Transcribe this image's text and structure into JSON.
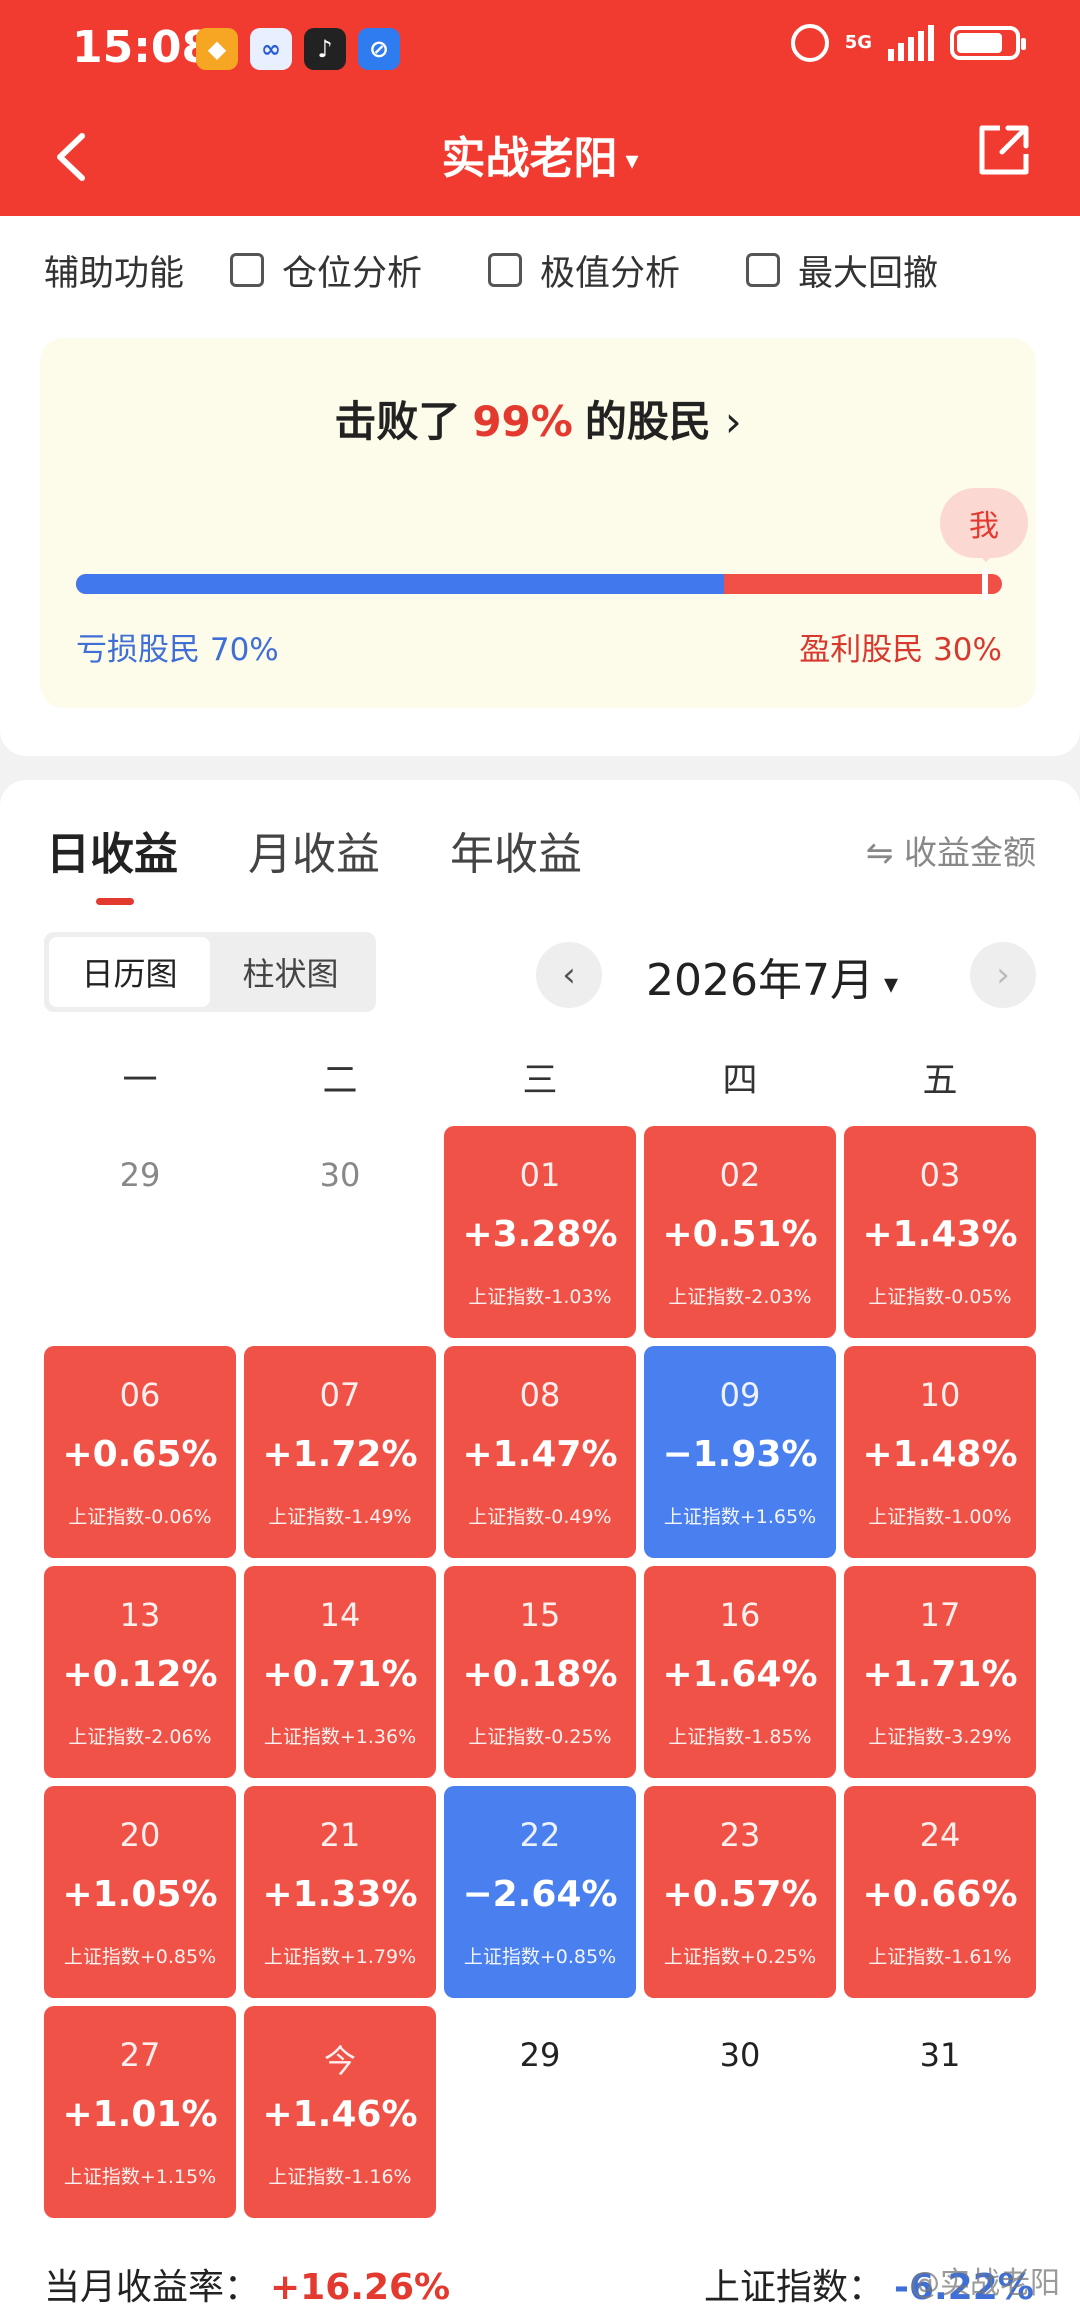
{
  "status_bar": {
    "time": "15:08",
    "network": "5G",
    "icons": [
      "app-icon-1",
      "app-icon-2",
      "app-icon-3",
      "app-icon-4",
      "alarm-icon",
      "signal-icon",
      "battery-icon"
    ]
  },
  "nav": {
    "title": "实战老阳",
    "caret": "▾",
    "back_icon": "chevron-left-icon",
    "share_icon": "share-icon"
  },
  "aux": {
    "title": "辅助功能",
    "options": [
      {
        "label": "仓位分析",
        "checked": false
      },
      {
        "label": "极值分析",
        "checked": false
      },
      {
        "label": "最大回撤",
        "checked": false
      }
    ]
  },
  "beat": {
    "prefix": "击败了",
    "percent": "99%",
    "suffix": "的股民",
    "arrow": "›",
    "me_label": "我",
    "loss_label": "亏损股民 70%",
    "gain_label": "盈利股民 30%",
    "loss_fraction": 0.7,
    "my_position": 0.99
  },
  "tabs": {
    "items": [
      "日收益",
      "月收益",
      "年收益"
    ],
    "active": 0,
    "amount_toggle": "⇋ 收益金额"
  },
  "view_toggle": {
    "options": [
      "日历图",
      "柱状图"
    ],
    "active": 0
  },
  "month_nav": {
    "label": "2026年7月",
    "caret": "▾",
    "prev": "‹",
    "next": "›"
  },
  "weekdays": [
    "一",
    "二",
    "三",
    "四",
    "五"
  ],
  "calendar": [
    {
      "day": "29",
      "type": "empty"
    },
    {
      "day": "30",
      "type": "empty"
    },
    {
      "day": "01",
      "type": "up",
      "value": "+3.28%",
      "index": "上证指数-1.03%"
    },
    {
      "day": "02",
      "type": "up",
      "value": "+0.51%",
      "index": "上证指数-2.03%"
    },
    {
      "day": "03",
      "type": "up",
      "value": "+1.43%",
      "index": "上证指数-0.05%"
    },
    {
      "day": "06",
      "type": "up",
      "value": "+0.65%",
      "index": "上证指数-0.06%"
    },
    {
      "day": "07",
      "type": "up",
      "value": "+1.72%",
      "index": "上证指数-1.49%"
    },
    {
      "day": "08",
      "type": "up",
      "value": "+1.47%",
      "index": "上证指数-0.49%"
    },
    {
      "day": "09",
      "type": "down",
      "value": "−1.93%",
      "index": "上证指数+1.65%"
    },
    {
      "day": "10",
      "type": "up",
      "value": "+1.48%",
      "index": "上证指数-1.00%"
    },
    {
      "day": "13",
      "type": "up",
      "value": "+0.12%",
      "index": "上证指数-2.06%"
    },
    {
      "day": "14",
      "type": "up",
      "value": "+0.71%",
      "index": "上证指数+1.36%"
    },
    {
      "day": "15",
      "type": "up",
      "value": "+0.18%",
      "index": "上证指数-0.25%"
    },
    {
      "day": "16",
      "type": "up",
      "value": "+1.64%",
      "index": "上证指数-1.85%"
    },
    {
      "day": "17",
      "type": "up",
      "value": "+1.71%",
      "index": "上证指数-3.29%"
    },
    {
      "day": "20",
      "type": "up",
      "value": "+1.05%",
      "index": "上证指数+0.85%"
    },
    {
      "day": "21",
      "type": "up",
      "value": "+1.33%",
      "index": "上证指数+1.79%"
    },
    {
      "day": "22",
      "type": "down",
      "value": "−2.64%",
      "index": "上证指数+0.85%"
    },
    {
      "day": "23",
      "type": "up",
      "value": "+0.57%",
      "index": "上证指数+0.25%"
    },
    {
      "day": "24",
      "type": "up",
      "value": "+0.66%",
      "index": "上证指数-1.61%"
    },
    {
      "day": "27",
      "type": "up",
      "value": "+1.01%",
      "index": "上证指数+1.15%"
    },
    {
      "day": "今",
      "type": "up",
      "value": "+1.46%",
      "index": "上证指数-1.16%"
    },
    {
      "day": "29",
      "type": "future"
    },
    {
      "day": "30",
      "type": "future"
    },
    {
      "day": "31",
      "type": "future"
    }
  ],
  "summary": {
    "month_label": "当月收益率：",
    "month_value": "+16.26%",
    "index_label": "上证指数：",
    "index_value": "-6.22%"
  },
  "watermark": "@实战老阳",
  "colors": {
    "header": "#f23b30",
    "gain": "#f15247",
    "loss": "#4a7ff0",
    "accent_red": "#e4392f",
    "accent_blue": "#3f6fd6"
  }
}
